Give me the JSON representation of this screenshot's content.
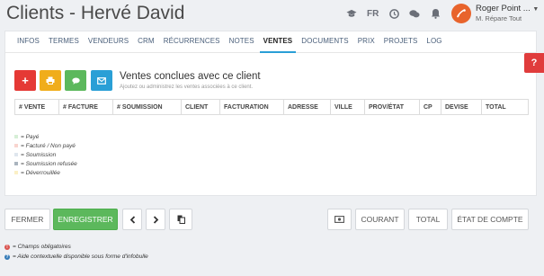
{
  "header": {
    "title": "Clients - Hervé David",
    "lang": "FR",
    "user_name": "Roger Point ...",
    "user_sub": "M. Répare Tout"
  },
  "tabs": [
    {
      "label": "INFOS",
      "active": false
    },
    {
      "label": "TERMES",
      "active": false
    },
    {
      "label": "VENDEURS",
      "active": false
    },
    {
      "label": "CRM",
      "active": false
    },
    {
      "label": "RÉCURRENCES",
      "active": false
    },
    {
      "label": "NOTES",
      "active": false
    },
    {
      "label": "VENTES",
      "active": true
    },
    {
      "label": "DOCUMENTS",
      "active": false
    },
    {
      "label": "PRIX",
      "active": false
    },
    {
      "label": "PROJETS",
      "active": false
    },
    {
      "label": "LOG",
      "active": false
    }
  ],
  "section": {
    "title": "Ventes conclues avec ce client",
    "subtitle": "Ajoutez ou administrez les ventes associées à ce client."
  },
  "table": {
    "columns": [
      "# VENTE",
      "# FACTURE",
      "# SOUMISSION",
      "CLIENT",
      "FACTURATION",
      "ADRESSE",
      "VILLE",
      "PROV/ÉTAT",
      "CP",
      "DEVISE",
      "TOTAL"
    ]
  },
  "legend": [
    {
      "label": "= Payé",
      "color": "#d6efd6"
    },
    {
      "label": "= Facturé / Non payé",
      "color": "#f9d5cf"
    },
    {
      "label": "= Soumission",
      "color": "#dfe6ee"
    },
    {
      "label": "= Soumission refusée",
      "color": "#aab4be"
    },
    {
      "label": "= Déverrouillée",
      "color": "#fbf0c6"
    }
  ],
  "footer": {
    "close": "FERMER",
    "save": "ENREGISTRER",
    "current": "COURANT",
    "total": "TOTAL",
    "statement": "ÉTAT DE COMPTE"
  },
  "notes": [
    {
      "label": "= Champs obligatoires",
      "color": "#d9534f"
    },
    {
      "label": "= Aide contextuelle disponible sous forme d'infobulle",
      "color": "#337ab7"
    }
  ],
  "feedback_label": "?",
  "colors": {
    "accent": "#2a9fd6",
    "add": "#e53935",
    "print": "#f0ad1b",
    "comment": "#5cb85c",
    "email": "#2a9fd6",
    "save": "#5cb85c",
    "avatar": "#e8642c"
  }
}
